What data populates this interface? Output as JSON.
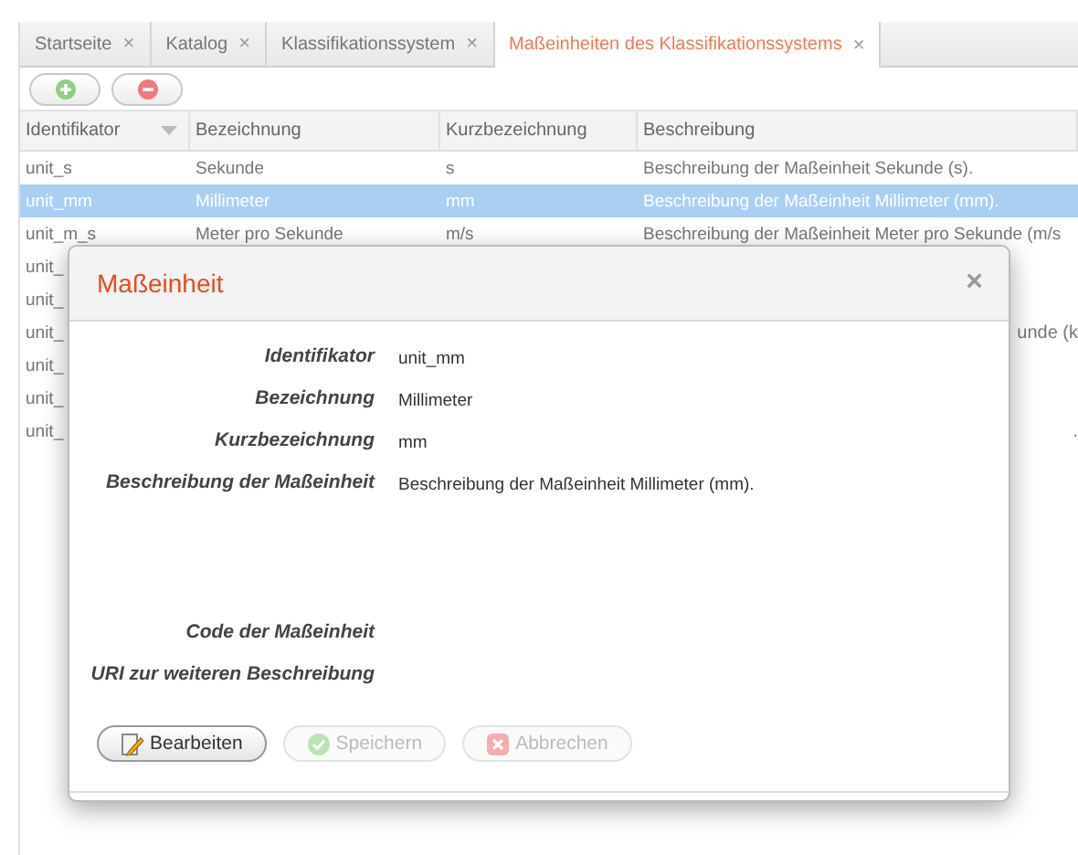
{
  "tabs": [
    {
      "label": "Startseite",
      "selected": false,
      "close": "×"
    },
    {
      "label": "Katalog",
      "selected": false,
      "close": "×"
    },
    {
      "label": "Klassifikationssystem",
      "selected": false,
      "close": "×"
    },
    {
      "label": "Maßeinheiten des Klassifikationssystems",
      "selected": true,
      "close": "×"
    }
  ],
  "table": {
    "columns": [
      {
        "label": "Identifikator",
        "sorted": true
      },
      {
        "label": "Bezeichnung",
        "sorted": false
      },
      {
        "label": "Kurzbezeichnung",
        "sorted": false
      },
      {
        "label": "Beschreibung",
        "sorted": false
      }
    ],
    "rows": [
      {
        "selected": false,
        "cells": [
          "unit_s",
          "Sekunde",
          "s",
          "Beschreibung der Maßeinheit Sekunde (s)."
        ]
      },
      {
        "selected": true,
        "cells": [
          "unit_mm",
          "Millimeter",
          "mm",
          "Beschreibung der Maßeinheit Millimeter (mm)."
        ]
      },
      {
        "selected": false,
        "cells": [
          "unit_m_s",
          "Meter pro Sekunde",
          "m/s",
          "Beschreibung der Maßeinheit Meter pro Sekunde (m/s"
        ]
      },
      {
        "cells": [
          "unit_"
        ]
      },
      {
        "cells": [
          "unit_"
        ]
      },
      {
        "cells": [
          "unit_"
        ],
        "tail": "unde (k"
      },
      {
        "cells": [
          "unit_"
        ]
      },
      {
        "cells": [
          "unit_"
        ]
      },
      {
        "cells": [
          "unit_"
        ],
        "tail": "."
      }
    ]
  },
  "dialog": {
    "title": "Maßeinheit",
    "close": "×",
    "fields": [
      {
        "label": "Identifikator",
        "value": "unit_mm"
      },
      {
        "label": "Bezeichnung",
        "value": "Millimeter"
      },
      {
        "label": "Kurzbezeichnung",
        "value": "mm"
      },
      {
        "label": "Beschreibung der Maßeinheit",
        "value": "Beschreibung der Maßeinheit Millimeter (mm).",
        "tall": true
      },
      {
        "label": "Code der Maßeinheit"
      },
      {
        "label": "URI zur weiteren Beschreibung"
      }
    ],
    "buttons": [
      {
        "label": "Bearbeiten",
        "kind": "edit",
        "disabled": false
      },
      {
        "label": "Speichern",
        "kind": "save",
        "disabled": true
      },
      {
        "label": "Abbrechen",
        "kind": "cancel",
        "disabled": true
      }
    ]
  }
}
